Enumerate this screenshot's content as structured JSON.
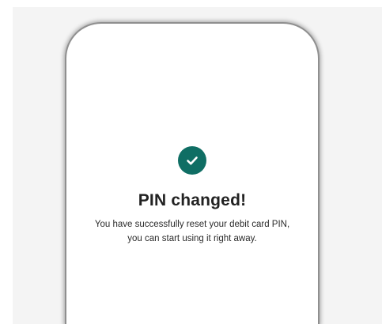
{
  "confirmation": {
    "icon": "check-circle-icon",
    "accent_color": "#0f6e64",
    "title": "PIN changed!",
    "message_line1": "You have successfully reset your debit card PIN,",
    "message_line2": "you can start using it right away."
  }
}
